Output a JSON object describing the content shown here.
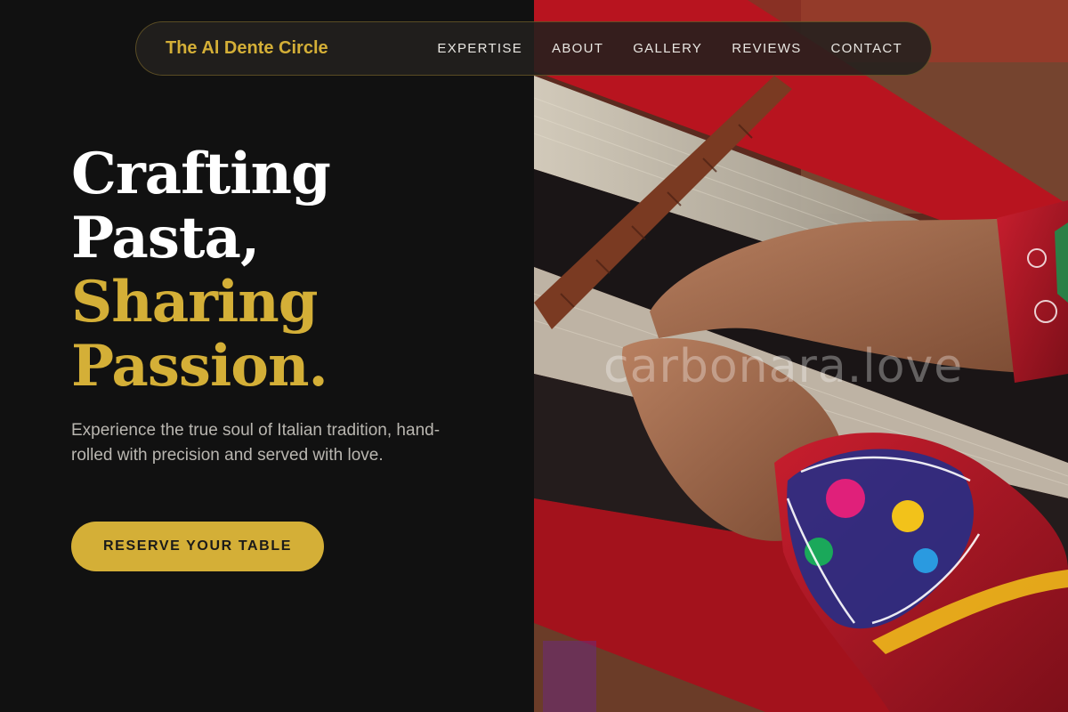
{
  "nav": {
    "brand": "The Al Dente Circle",
    "links": [
      "EXPERTISE",
      "ABOUT",
      "GALLERY",
      "REVIEWS",
      "CONTACT"
    ]
  },
  "hero": {
    "title_lines": [
      "Crafting",
      "Pasta,",
      "Sharing",
      "Passion."
    ],
    "subtitle": "Experience the true soul of Italian tradition, hand-rolled with precision and served with love.",
    "cta_label": "RESERVE YOUR TABLE",
    "image_alt": "Hands weaving colorful threads on a traditional loom",
    "watermark": "carbonara.love"
  },
  "colors": {
    "background": "#111111",
    "accent_gold": "#d4af37",
    "text_light": "#ffffff",
    "text_muted": "#b9b6b0"
  },
  "icons": []
}
